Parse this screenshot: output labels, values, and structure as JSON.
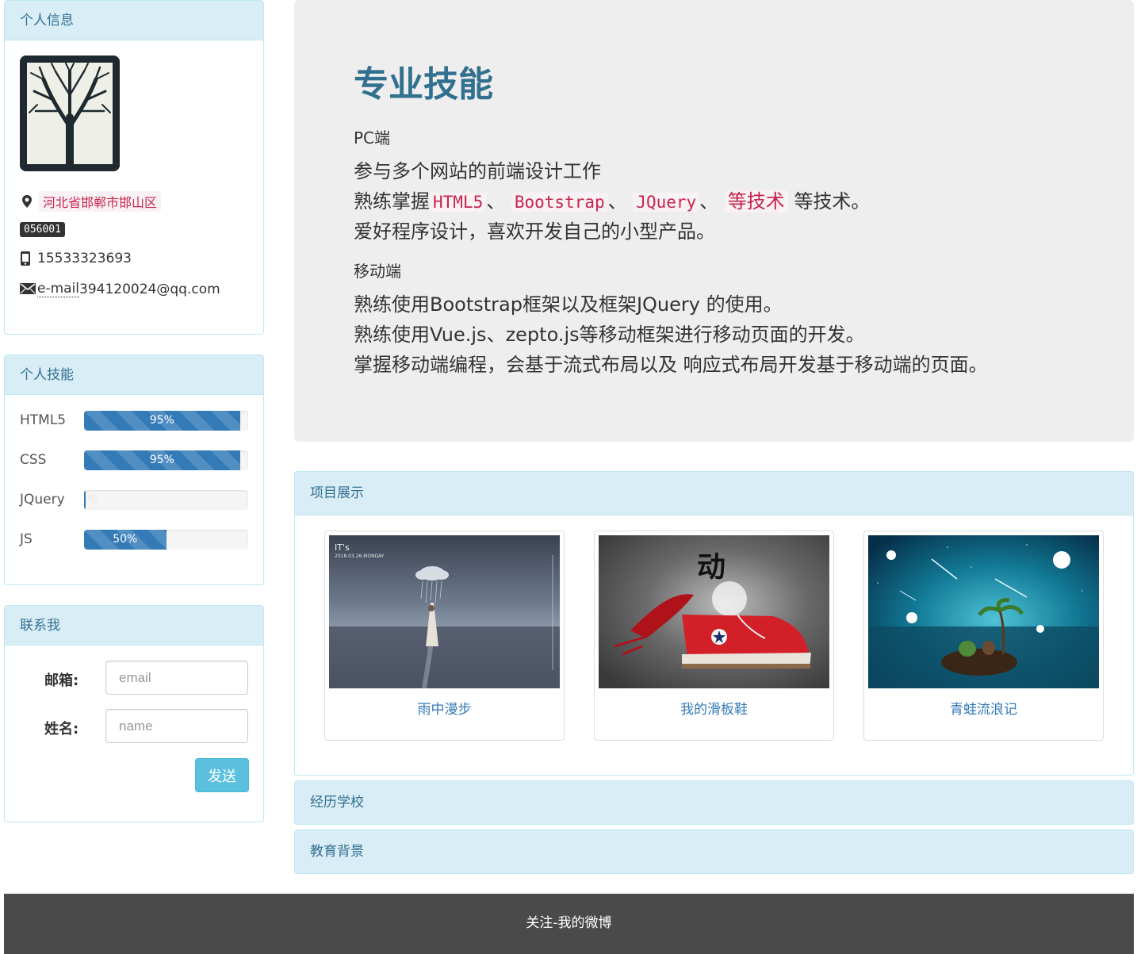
{
  "info_panel": {
    "title": "个人信息",
    "address": "河北省邯郸市邯山区",
    "zip": "056001",
    "phone": "15533323693",
    "email_abbr": "e-mail",
    "email": "394120024@qq.com"
  },
  "skills_panel": {
    "title": "个人技能",
    "skills": [
      {
        "label": "HTML5",
        "percent": 95,
        "text": "95%"
      },
      {
        "label": "CSS",
        "percent": 95,
        "text": "95%"
      },
      {
        "label": "JQuery",
        "percent": 1,
        "text": "%"
      },
      {
        "label": "JS",
        "percent": 50,
        "text": "50%"
      }
    ]
  },
  "contact_panel": {
    "title": "联系我",
    "email_label": "邮箱:",
    "email_placeholder": "email",
    "name_label": "姓名:",
    "name_placeholder": "name",
    "send_label": "发送"
  },
  "jumbotron": {
    "title": "专业技能",
    "pc_heading": "PC端",
    "pc_line1": "参与多个网站的前端设计工作",
    "pc_line2_prefix": "熟练掌握",
    "pc_code1": "HTML5",
    "pc_sep1": "、",
    "pc_code2": "Bootstrap",
    "pc_sep2": "、",
    "pc_code3": "JQuery",
    "pc_sep3": "、",
    "pc_code4": "等技术",
    "pc_line2_suffix": "等技术。",
    "pc_line3": "爱好程序设计，喜欢开发自己的小型产品。",
    "mobile_heading": "移动端",
    "mobile_line1": "熟练使用Bootstrap框架以及框架JQuery 的使用。",
    "mobile_line2": "熟练使用Vue.js、zepto.js等移动框架进行移动页面的开发。",
    "mobile_line3": "掌握移动端编程，会基于流式布局以及 响应式布局开发基于移动端的页面。"
  },
  "projects_panel": {
    "title": "项目展示",
    "items": [
      {
        "caption": "雨中漫步",
        "image_text_1": "IT's",
        "image_text_2": "2018.03.26.MONDAY"
      },
      {
        "caption": "我的滑板鞋",
        "image_text_1": "动"
      },
      {
        "caption": "青蛙流浪记"
      }
    ]
  },
  "school_panel": {
    "title": "经历学校"
  },
  "education_panel": {
    "title": "教育背景"
  },
  "footer": {
    "text": "关注-我的微博"
  },
  "colors": {
    "heading_bg": "#d9edf7",
    "heading_text": "#31708f",
    "progress": "#337ab7",
    "code": "#c7254e",
    "button": "#5bc0de",
    "footer_bg": "#4a4a4a"
  }
}
